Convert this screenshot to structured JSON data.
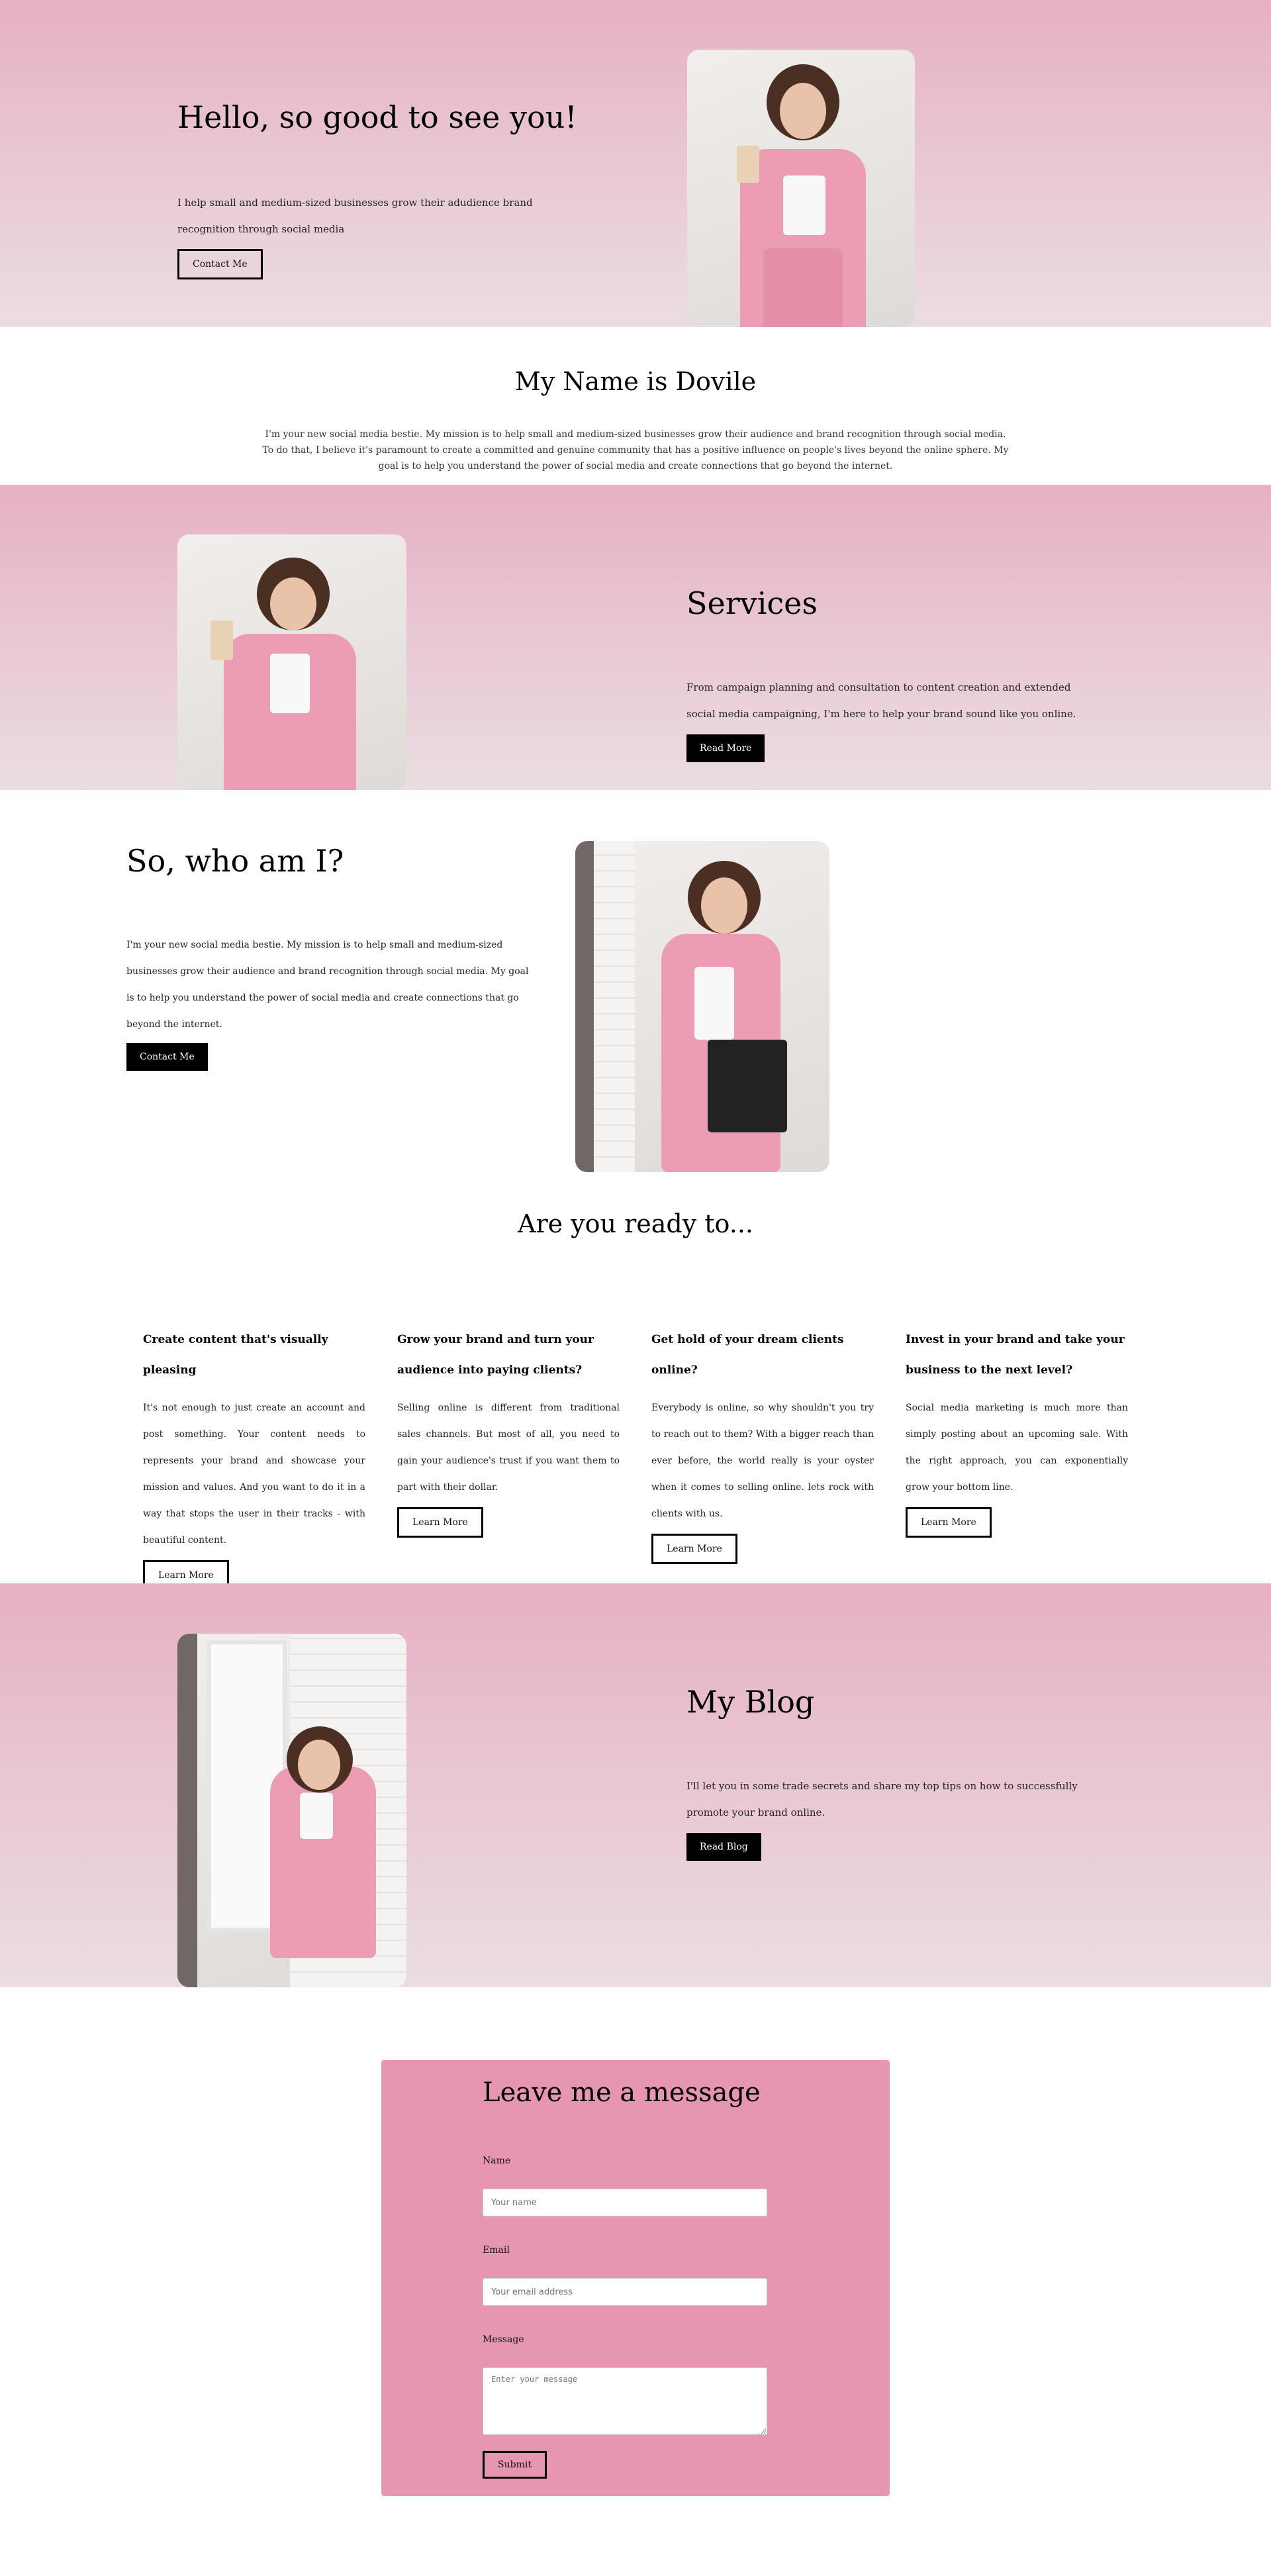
{
  "hero": {
    "title": "Hello, so good to see you!",
    "text": "I help small and medium-sized businesses grow their adudience brand recognition through social media",
    "button": "Contact Me"
  },
  "about_intro": {
    "title": "My Name is Dovile",
    "text": "I'm your new social media bestie. My mission is to help small and medium-sized businesses grow their audience and brand recognition through social media. To do that, I believe it's paramount to create a committed and genuine community that has a positive influence on people's lives beyond the online sphere. My goal is to help you understand the power of social media and create connections that go beyond the internet."
  },
  "services": {
    "title": "Services",
    "text": "From campaign planning and consultation to content creation and extended social media campaigning, I'm here to help your brand sound like you online.",
    "button": "Read More"
  },
  "who": {
    "title": "So, who am I?",
    "text": "I'm your new social media bestie. My mission is to help small and medium-sized businesses grow their audience and brand recognition through social media. My goal is to help you understand the power of social media and create connections that go beyond the internet.",
    "button": "Contact Me"
  },
  "ready": {
    "title": "Are you ready to...",
    "cards": [
      {
        "title": "Create content that's visually pleasing",
        "text": "It's not enough to just create an account and post something. Your content needs to represents your brand and showcase your mission and values. And you want to do it in a way that stops the user in their tracks - with beautiful content.",
        "button": "Learn More"
      },
      {
        "title": "Grow your brand and turn your audience into paying clients?",
        "text": "Selling online is different from traditional sales channels. But most of all, you need to gain your audience's trust if you want them to part with their dollar.",
        "button": "Learn More"
      },
      {
        "title": "Get hold of your dream clients online?",
        "text": "Everybody is online, so why shouldn't you try to reach out to them? With a bigger reach than ever before, the world really is your oyster when it comes to selling online. lets rock with clients with us.",
        "button": "Learn More"
      },
      {
        "title": "Invest in your brand and take your business to the next level?",
        "text": "Social media marketing is much more than simply posting about an upcoming sale. With the right approach, you can exponentially grow your bottom line.",
        "button": "Learn More"
      }
    ]
  },
  "blog": {
    "title": "My Blog",
    "text": "I'll let you in some trade secrets and share my top tips on how to successfully promote your brand online.",
    "button": "Read Blog"
  },
  "contact": {
    "title": "Leave me a message",
    "name_label": "Name",
    "name_placeholder": "Your name",
    "email_label": "Email",
    "email_placeholder": "Your email address",
    "message_label": "Message",
    "message_placeholder": "Enter your message",
    "submit": "Submit"
  },
  "colors": {
    "pink_top": "#e6b1c4",
    "pink_bottom": "#ebdde2",
    "form_bg": "#e796b1",
    "button_black": "#000000"
  }
}
